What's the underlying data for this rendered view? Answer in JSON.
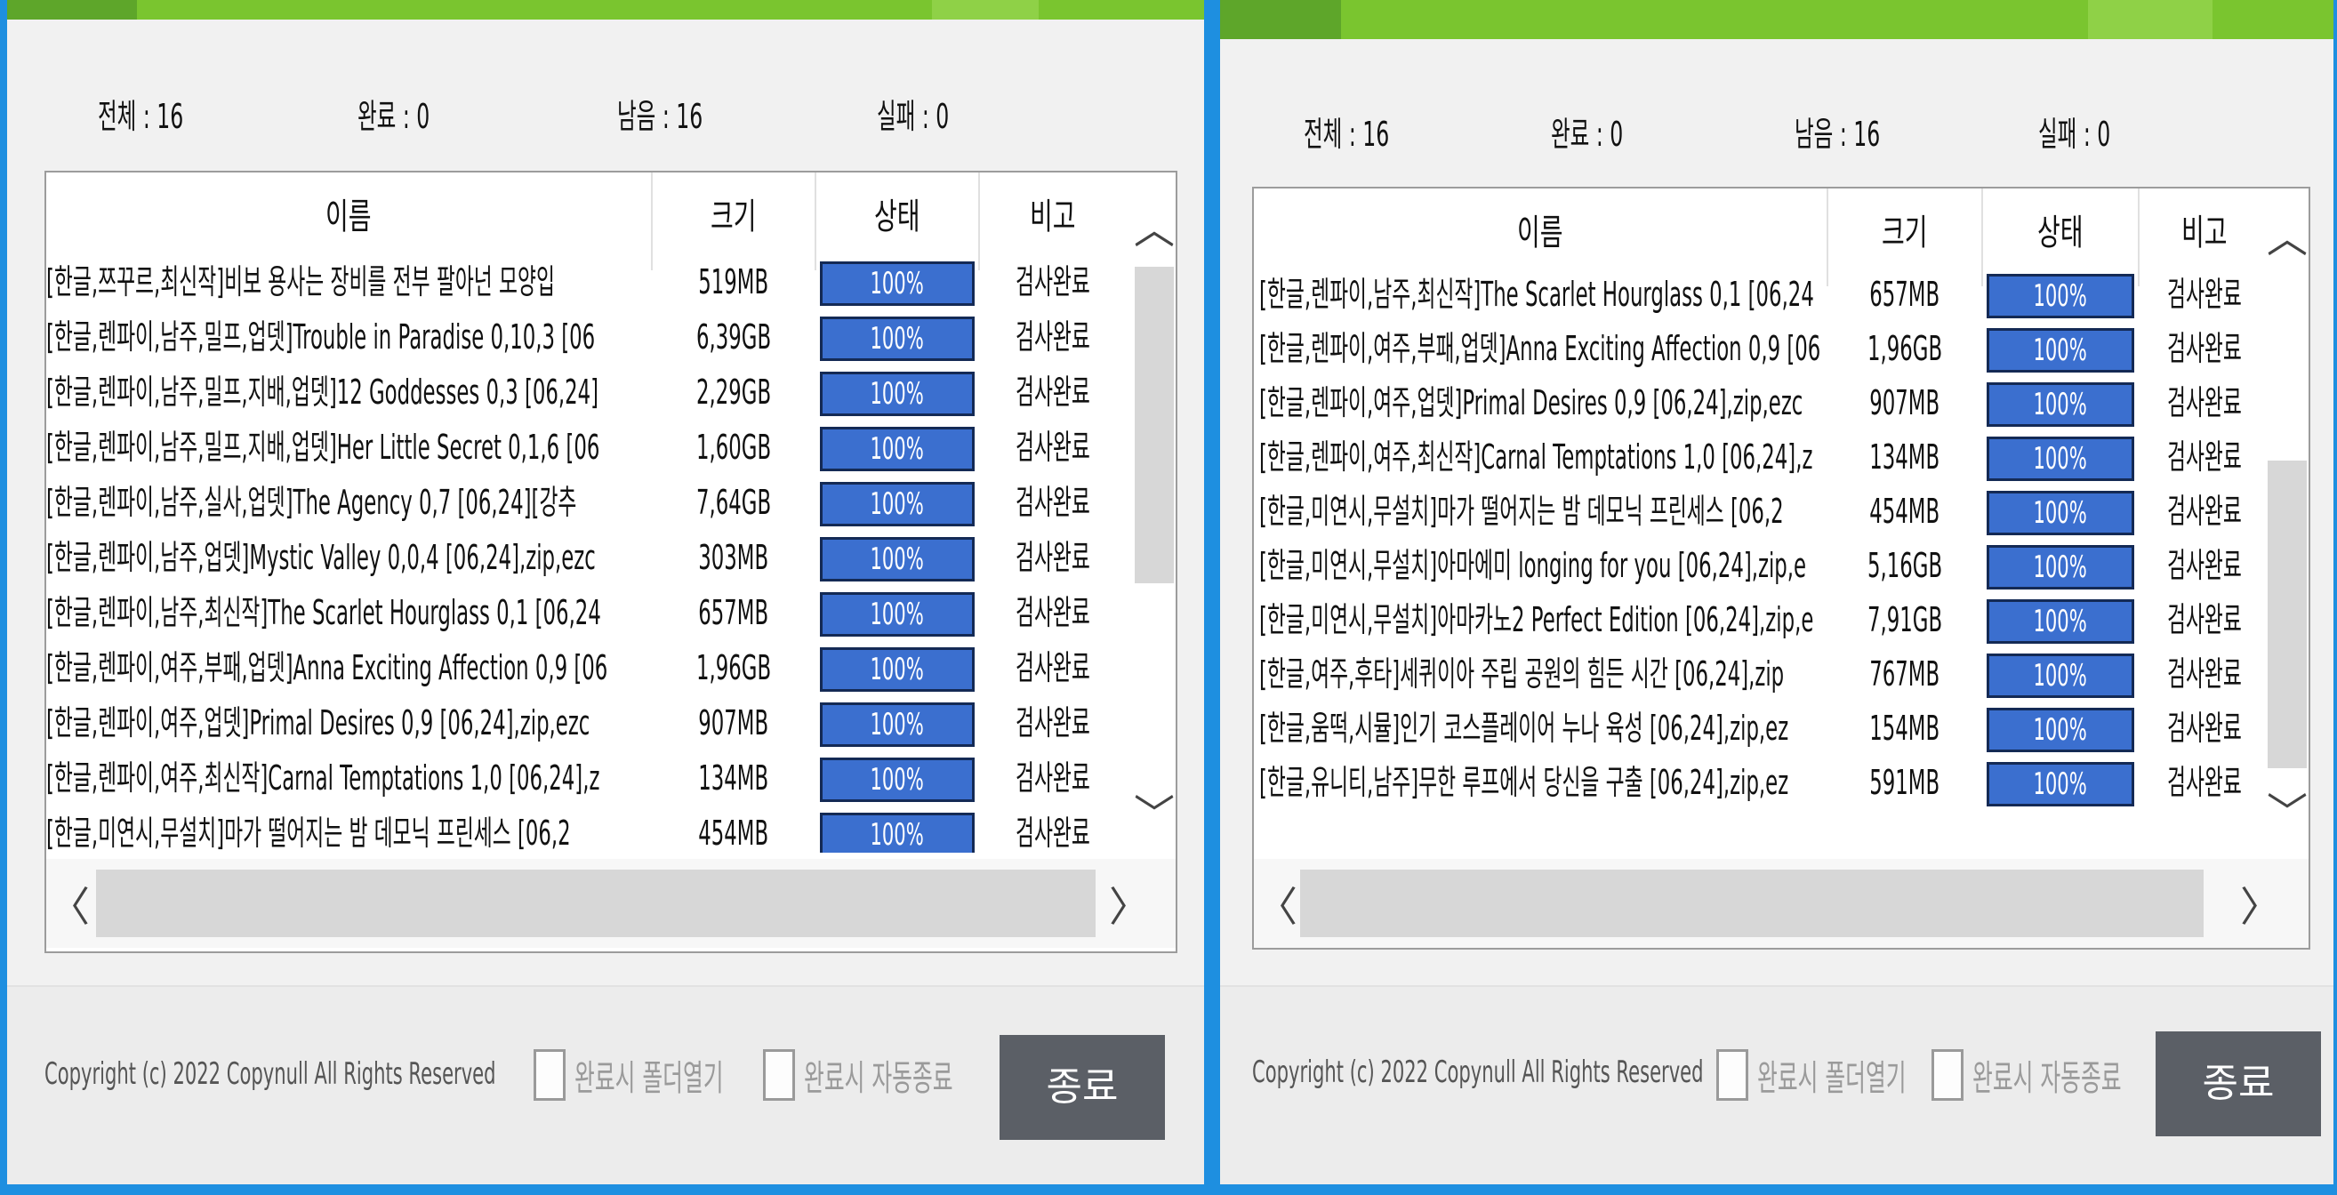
{
  "colors": {
    "titlebar": "#7ac52f",
    "titlebar_dark": "#5ea62a",
    "progress": "#3b6fcf",
    "button": "#5b5f66",
    "desktop": "#1e8fe0"
  },
  "left": {
    "stats": {
      "total": "전체 : 16",
      "done": "완료 : 0",
      "remaining": "남음 : 16",
      "failed": "실패 : 0"
    },
    "columns": [
      "이름",
      "크기",
      "상태",
      "비고"
    ],
    "rows": [
      {
        "name": "[한글,쯔꾸르,최신작]비보 용사는 장비를 전부 팔아넌 모양입",
        "size": "519MB",
        "status": "100%",
        "progress": 100,
        "note": "검사완료"
      },
      {
        "name": "[한글,렌파이,남주,밀프,업뎃]Trouble in Paradise 0,10,3 [06",
        "size": "6,39GB",
        "status": "100%",
        "progress": 100,
        "note": "검사완료"
      },
      {
        "name": "[한글,렌파이,남주,밀프,지배,업뎃]12 Goddesses 0,3 [06,24]",
        "size": "2,29GB",
        "status": "100%",
        "progress": 100,
        "note": "검사완료"
      },
      {
        "name": "[한글,렌파이,남주,밀프,지배,업뎃]Her Little Secret 0,1,6 [06",
        "size": "1,60GB",
        "status": "100%",
        "progress": 100,
        "note": "검사완료"
      },
      {
        "name": "[한글,렌파이,남주,실사,업뎃]The Agency 0,7 [06,24][강추",
        "size": "7,64GB",
        "status": "100%",
        "progress": 100,
        "note": "검사완료"
      },
      {
        "name": "[한글,렌파이,남주,업뎃]Mystic Valley 0,0,4 [06,24],zip,ezc",
        "size": "303MB",
        "status": "100%",
        "progress": 100,
        "note": "검사완료"
      },
      {
        "name": "[한글,렌파이,남주,최신작]The Scarlet Hourglass 0,1 [06,24",
        "size": "657MB",
        "status": "100%",
        "progress": 100,
        "note": "검사완료"
      },
      {
        "name": "[한글,렌파이,여주,부패,업뎃]Anna Exciting Affection 0,9 [06",
        "size": "1,96GB",
        "status": "100%",
        "progress": 100,
        "note": "검사완료"
      },
      {
        "name": "[한글,렌파이,여주,업뎃]Primal Desires 0,9 [06,24],zip,ezc",
        "size": "907MB",
        "status": "100%",
        "progress": 100,
        "note": "검사완료"
      },
      {
        "name": "[한글,렌파이,여주,최신작]Carnal Temptations 1,0 [06,24],z",
        "size": "134MB",
        "status": "100%",
        "progress": 100,
        "note": "검사완료"
      },
      {
        "name": "[한글,미연시,무설치]마가 떨어지는 밤 데모닉 프린세스 [06,2",
        "size": "454MB",
        "status": "100%",
        "progress": 100,
        "note": "검사완료"
      }
    ],
    "footer": {
      "copyright": "Copyright (c) 2022 Copynull All Rights Reserved",
      "chk_open_folder": "완료시 폴더열기",
      "chk_auto_close": "완료시 자동종료",
      "exit_button": "종료"
    }
  },
  "right": {
    "stats": {
      "total": "전체 : 16",
      "done": "완료 : 0",
      "remaining": "남음 : 16",
      "failed": "실패 : 0"
    },
    "columns": [
      "이름",
      "크기",
      "상태",
      "비고"
    ],
    "rows": [
      {
        "name": "[한글,렌파이,남주,최신작]The Scarlet Hourglass 0,1 [06,24",
        "size": "657MB",
        "status": "100%",
        "progress": 100,
        "note": "검사완료"
      },
      {
        "name": "[한글,렌파이,여주,부패,업뎃]Anna Exciting Affection 0,9 [06",
        "size": "1,96GB",
        "status": "100%",
        "progress": 100,
        "note": "검사완료"
      },
      {
        "name": "[한글,렌파이,여주,업뎃]Primal Desires 0,9 [06,24],zip,ezc",
        "size": "907MB",
        "status": "100%",
        "progress": 100,
        "note": "검사완료"
      },
      {
        "name": "[한글,렌파이,여주,최신작]Carnal Temptations 1,0 [06,24],z",
        "size": "134MB",
        "status": "100%",
        "progress": 100,
        "note": "검사완료"
      },
      {
        "name": "[한글,미연시,무설치]마가 떨어지는 밤 데모닉 프린세스 [06,2",
        "size": "454MB",
        "status": "100%",
        "progress": 100,
        "note": "검사완료"
      },
      {
        "name": "[한글,미연시,무설치]아마에미 longing for you [06,24],zip,e",
        "size": "5,16GB",
        "status": "100%",
        "progress": 100,
        "note": "검사완료"
      },
      {
        "name": "[한글,미연시,무설치]아마카노2 Perfect Edition [06,24],zip,e",
        "size": "7,91GB",
        "status": "100%",
        "progress": 100,
        "note": "검사완료"
      },
      {
        "name": "[한글,여주,후타]세퀴이아 주립 공원의 힘든 시간 [06,24],zip",
        "size": "767MB",
        "status": "100%",
        "progress": 100,
        "note": "검사완료"
      },
      {
        "name": "[한글,움떡,시뮬]인기 코스플레이어 누나 육성 [06,24],zip,ez",
        "size": "154MB",
        "status": "100%",
        "progress": 100,
        "note": "검사완료"
      },
      {
        "name": "[한글,유니티,남주]무한 루프에서 당신을 구출 [06,24],zip,ez",
        "size": "591MB",
        "status": "100%",
        "progress": 100,
        "note": "검사완료"
      }
    ],
    "footer": {
      "copyright": "Copyright (c) 2022 Copynull All Rights Reserved",
      "chk_open_folder": "완료시 폴더열기",
      "chk_auto_close": "완료시 자동종료",
      "exit_button": "종료"
    }
  },
  "icons": {
    "scroll_up": "▲",
    "scroll_down": "▼",
    "scroll_left": "‹",
    "scroll_right": "›"
  }
}
